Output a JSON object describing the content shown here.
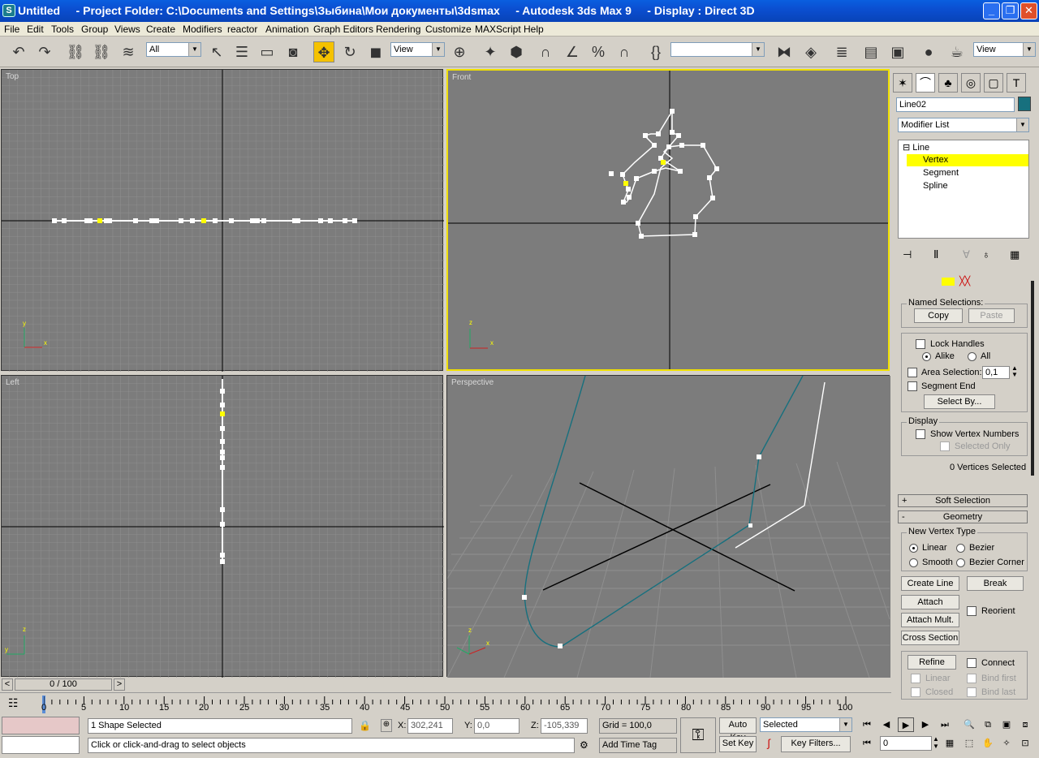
{
  "window": {
    "title": "Untitled     - Project Folder: C:\\Documents and Settings\\Зыбина\\Мои документы\\3dsmax     - Autodesk 3ds Max 9     - Display : Direct 3D",
    "icon": "3ds-max-logo-icon"
  },
  "menu": [
    "File",
    "Edit",
    "Tools",
    "Group",
    "Views",
    "Create",
    "Modifiers",
    "reactor",
    "Animation",
    "Graph Editors",
    "Rendering",
    "Customize",
    "MAXScript",
    "Help"
  ],
  "toolbar": {
    "filter": "All",
    "refcoord": "View",
    "named_sel": "",
    "view2": "View"
  },
  "viewports": {
    "top": "Top",
    "front": "Front",
    "left": "Left",
    "perspective": "Perspective"
  },
  "axes": {
    "x": "x",
    "y": "y",
    "z": "z"
  },
  "panel": {
    "object_name": "Line02",
    "object_color": "#17707e",
    "modifier_list": "Modifier List",
    "stack": [
      "Line",
      "Vertex",
      "Segment",
      "Spline"
    ],
    "named_selections": "Named Selections:",
    "copy": "Copy",
    "paste": "Paste",
    "lock_handles": "Lock Handles",
    "alike": "Alike",
    "all": "All",
    "area_selection": "Area Selection:",
    "area_value": "0,1",
    "segment_end": "Segment End",
    "select_by": "Select By...",
    "display": "Display",
    "show_vertex_numbers": "Show Vertex Numbers",
    "selected_only": "Selected Only",
    "vertices_selected": "0 Vertices Selected",
    "soft_selection": "Soft Selection",
    "geometry": "Geometry",
    "new_vertex_type": "New Vertex Type",
    "linear": "Linear",
    "bezier": "Bezier",
    "smooth": "Smooth",
    "bezier_corner": "Bezier Corner",
    "create_line": "Create Line",
    "break": "Break",
    "attach": "Attach",
    "reorient": "Reorient",
    "attach_mult": "Attach Mult.",
    "cross_section": "Cross Section",
    "refine": "Refine",
    "connect": "Connect",
    "linear2": "Linear",
    "bind_first": "Bind first",
    "closed": "Closed",
    "bind_last": "Bind last"
  },
  "timeline": {
    "slider": "0 / 100",
    "ticks": [
      "0",
      "5",
      "10",
      "15",
      "20",
      "25",
      "30",
      "35",
      "40",
      "45",
      "50",
      "55",
      "60",
      "65",
      "70",
      "75",
      "80",
      "85",
      "90",
      "95",
      "100"
    ]
  },
  "status": {
    "selected": "1 Shape Selected",
    "prompt": "Click or click-and-drag to select objects",
    "x_label": "X:",
    "x": "302,241",
    "y_label": "Y:",
    "y": "0,0",
    "z_label": "Z:",
    "z": "-105,339",
    "grid": "Grid = 100,0",
    "add_time_tag": "Add Time Tag",
    "auto_key": "Auto Key",
    "set_key": "Set Key",
    "key_mode": "Selected",
    "key_filters": "Key Filters...",
    "frame": "0"
  }
}
